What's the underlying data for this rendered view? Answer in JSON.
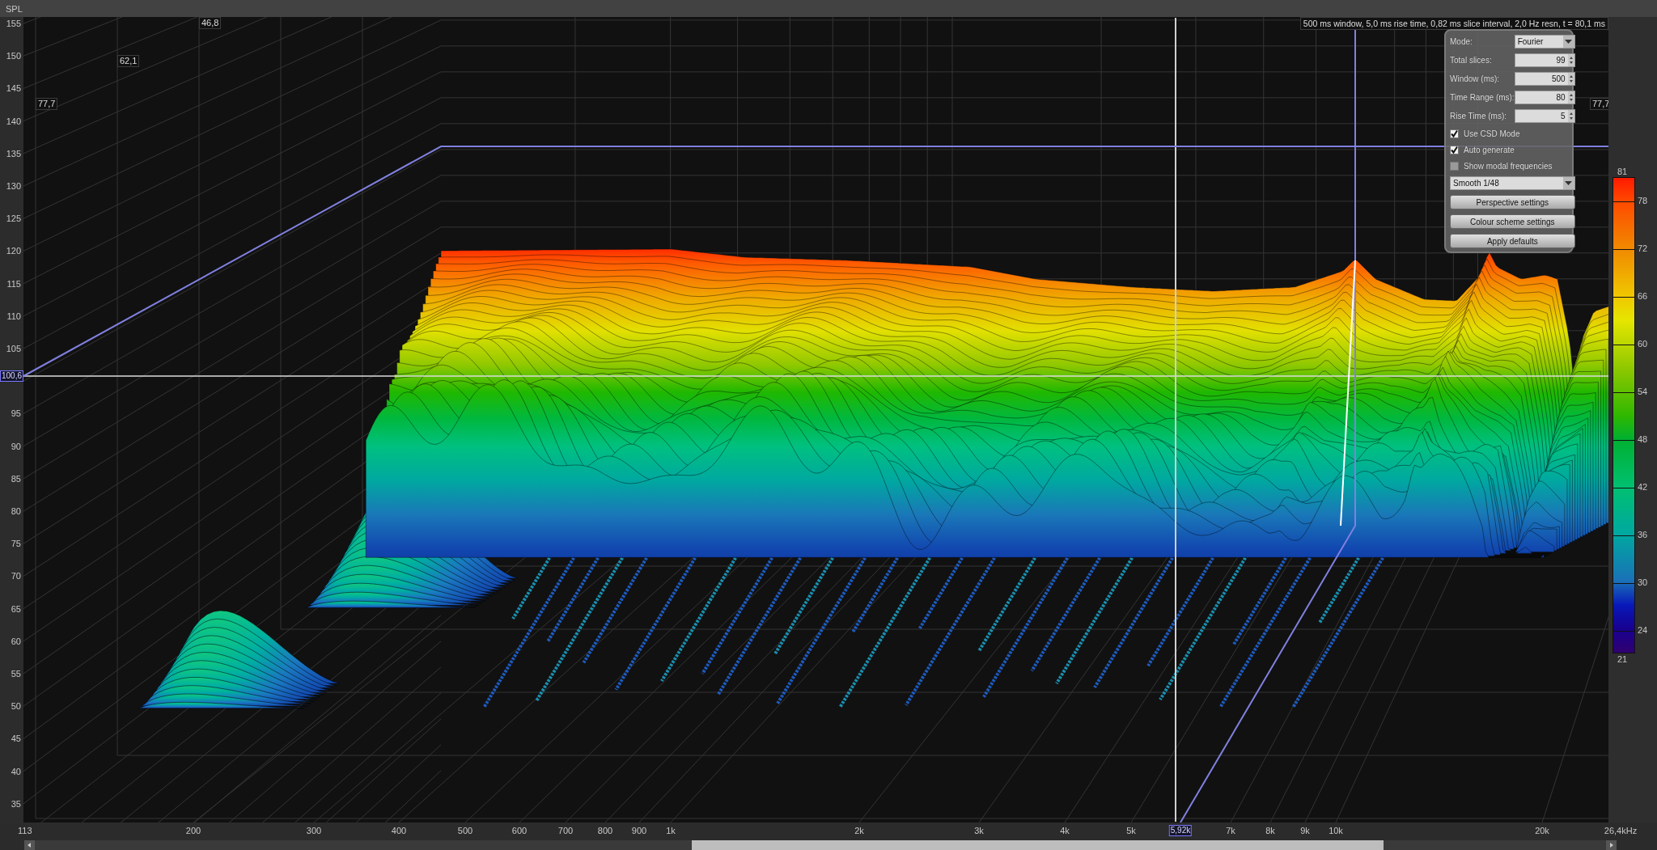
{
  "y_axis": {
    "title": "SPL",
    "ticks": [
      "155",
      "150",
      "145",
      "140",
      "135",
      "130",
      "125",
      "120",
      "115",
      "110",
      "105",
      "95",
      "90",
      "85",
      "80",
      "75",
      "70",
      "65",
      "60",
      "55",
      "50",
      "45",
      "40",
      "35"
    ],
    "cursor_readout": "100,6"
  },
  "x_axis": {
    "ticks": [
      "113",
      "200",
      "300",
      "400",
      "500",
      "600",
      "700",
      "800",
      "900",
      "1k",
      "2k",
      "3k",
      "4k",
      "5k",
      "7k",
      "8k",
      "9k",
      "10k",
      "20k",
      "26,4kHz"
    ],
    "cursor_readout": "5,92k"
  },
  "time_markers": [
    "77,7",
    "62,1",
    "46,8",
    "77,7"
  ],
  "info": "500 ms window, 5,0 ms rise time, 0,82 ms slice interval, 2,0 Hz resn, t = 80,1 ms",
  "settings": {
    "mode": {
      "label": "Mode:",
      "value": "Fourier"
    },
    "fields": [
      {
        "label": "Total slices:",
        "value": "99"
      },
      {
        "label": "Window (ms):",
        "value": "500"
      },
      {
        "label": "Time Range (ms):",
        "value": "80"
      },
      {
        "label": "Rise Time (ms):",
        "value": "5"
      }
    ],
    "checkboxes": [
      {
        "label": "Use CSD Mode",
        "checked": true
      },
      {
        "label": "Auto generate",
        "checked": true
      },
      {
        "label": "Show modal frequencies",
        "checked": false
      }
    ],
    "smoothing": "Smooth 1/48",
    "buttons": [
      "Perspective settings",
      "Colour scheme settings",
      "Apply defaults"
    ]
  },
  "colour_scale": {
    "ticks": [
      "81",
      "78",
      "72",
      "66",
      "60",
      "54",
      "48",
      "42",
      "36",
      "30",
      "24",
      "21"
    ]
  }
}
